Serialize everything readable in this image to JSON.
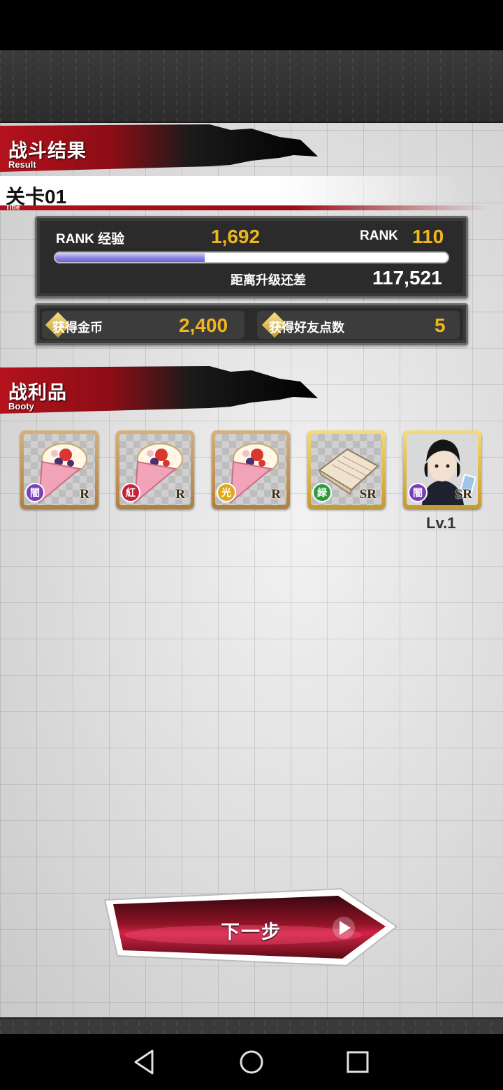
{
  "header": {
    "result_title": "战斗结果",
    "result_sub": "Result",
    "stage_title": "关卡01",
    "stage_sub": "Title"
  },
  "rank": {
    "exp_label": "RANK 经验",
    "exp_value": "1,692",
    "rank_label": "RANK",
    "rank_value": "110",
    "exp_progress": 0.38,
    "remaining_label": "距离升级还差",
    "remaining_value": "117,521"
  },
  "rewards": {
    "coins_label": "获得金币",
    "coins_value": "2,400",
    "friend_label": "获得好友点数",
    "friend_value": "5"
  },
  "booty": {
    "title": "战利品",
    "sub": "Booty",
    "items": [
      {
        "name": "crepe-item",
        "attribute": "闇",
        "attribute_color": "#7a3fb8",
        "rarity": "R"
      },
      {
        "name": "crepe-item",
        "attribute": "紅",
        "attribute_color": "#c8223a",
        "rarity": "R"
      },
      {
        "name": "crepe-item",
        "attribute": "光",
        "attribute_color": "#e0a81a",
        "rarity": "R"
      },
      {
        "name": "paper-item",
        "attribute": "緑",
        "attribute_color": "#2e9a3e",
        "rarity": "SR"
      },
      {
        "name": "character-card",
        "attribute": "闇",
        "attribute_color": "#7a3fb8",
        "rarity": "SR",
        "level": "Lv.1"
      }
    ]
  },
  "next_button": {
    "label": "下一步"
  },
  "colors": {
    "accent_red": "#a00c16",
    "gold": "#f0b61c"
  },
  "nav": {
    "icons": [
      "back-icon",
      "home-icon",
      "recents-icon"
    ]
  }
}
